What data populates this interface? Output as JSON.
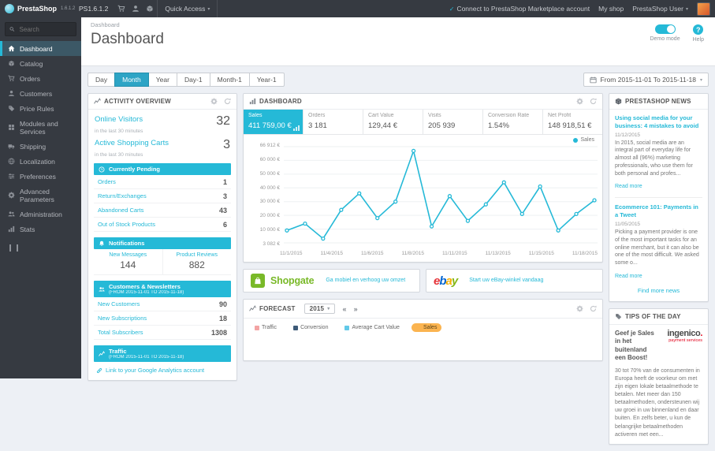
{
  "topbar": {
    "brand": "PrestaShop",
    "brand_version": "1.6.1.2",
    "shop_name": "PS1.6.1.2",
    "quick_access": "Quick Access",
    "marketplace": "Connect to PrestaShop Marketplace account",
    "my_shop": "My shop",
    "user": "PrestaShop User"
  },
  "sidebar": {
    "search_placeholder": "Search",
    "items": [
      {
        "label": "Dashboard",
        "active": true
      },
      {
        "label": "Catalog"
      },
      {
        "label": "Orders"
      },
      {
        "label": "Customers"
      },
      {
        "label": "Price Rules"
      },
      {
        "label": "Modules and Services"
      },
      {
        "label": "Shipping"
      },
      {
        "label": "Localization"
      },
      {
        "label": "Preferences"
      },
      {
        "label": "Advanced Parameters"
      },
      {
        "label": "Administration"
      },
      {
        "label": "Stats"
      }
    ]
  },
  "header": {
    "breadcrumb": "Dashboard",
    "title": "Dashboard",
    "demo_mode": "Demo mode",
    "help": "Help"
  },
  "filters": {
    "buttons": [
      "Day",
      "Month",
      "Year",
      "Day-1",
      "Month-1",
      "Year-1"
    ],
    "active": "Month",
    "date_range": "From 2015-11-01 To 2015-11-18"
  },
  "activity": {
    "title": "ACTIVITY OVERVIEW",
    "online_visitors": {
      "label": "Online Visitors",
      "value": "32",
      "sub": "in the last 30 minutes"
    },
    "active_carts": {
      "label": "Active Shopping Carts",
      "value": "3",
      "sub": "in the last 30 minutes"
    },
    "pending": {
      "title": "Currently Pending",
      "rows": [
        {
          "label": "Orders",
          "value": "1"
        },
        {
          "label": "Return/Exchanges",
          "value": "3"
        },
        {
          "label": "Abandoned Carts",
          "value": "43"
        },
        {
          "label": "Out of Stock Products",
          "value": "6"
        }
      ]
    },
    "notifications": {
      "title": "Notifications",
      "cols": [
        {
          "label": "New Messages",
          "value": "144"
        },
        {
          "label": "Product Reviews",
          "value": "882"
        }
      ]
    },
    "customers": {
      "title": "Customers & Newsletters",
      "subtitle": "(FROM 2015-11-01 TO 2015-11-18)",
      "rows": [
        {
          "label": "New Customers",
          "value": "90"
        },
        {
          "label": "New Subscriptions",
          "value": "18"
        },
        {
          "label": "Total Subscribers",
          "value": "1308"
        }
      ]
    },
    "traffic": {
      "title": "Traffic",
      "subtitle": "(FROM 2015-11-01 TO 2015-11-18)",
      "link": "Link to your Google Analytics account"
    }
  },
  "dashboard_panel": {
    "title": "DASHBOARD",
    "tabs": [
      {
        "label": "Sales",
        "value": "411 759,00 €",
        "active": true
      },
      {
        "label": "Orders",
        "value": "3 181"
      },
      {
        "label": "Cart Value",
        "value": "129,44 €"
      },
      {
        "label": "Visits",
        "value": "205 939"
      },
      {
        "label": "Conversion Rate",
        "value": "1.54%"
      },
      {
        "label": "Net Profit",
        "value": "148 918,51 €"
      }
    ],
    "legend": "Sales"
  },
  "chart_data": {
    "type": "line",
    "title": "Sales 2015-11-01 to 2015-11-18",
    "x": [
      "11/1/2015",
      "11/2/2015",
      "11/3/2015",
      "11/4/2015",
      "11/5/2015",
      "11/6/2015",
      "11/7/2015",
      "11/8/2015",
      "11/9/2015",
      "11/10/2015",
      "11/11/2015",
      "11/12/2015",
      "11/13/2015",
      "11/14/2015",
      "11/15/2015",
      "11/16/2015",
      "11/17/2015",
      "11/18/2015"
    ],
    "series": [
      {
        "name": "Sales",
        "color": "#25b9d7",
        "values": [
          9000,
          14000,
          3082,
          24000,
          36000,
          18000,
          30000,
          66912,
          12000,
          34000,
          16000,
          28000,
          44000,
          21000,
          41000,
          9000,
          21000,
          31000
        ]
      }
    ],
    "ylim": [
      0,
      70000
    ],
    "y_tick_labels": [
      "66 912 €",
      "60 000 €",
      "50 000 €",
      "40 000 €",
      "30 000 €",
      "20 000 €",
      "10 000 €",
      "3 082 €"
    ],
    "x_tick_labels": [
      "11/1/2015",
      "11/4/2015",
      "11/6/2015",
      "11/8/2015",
      "11/11/2015",
      "11/13/2015",
      "11/15/2015",
      "11/18/2015"
    ],
    "grid": true,
    "legend_position": "top-right"
  },
  "modules": {
    "shopgate": {
      "name": "Shopgate",
      "color": "#79b928",
      "link": "Ga mobiel en verhoog uw omzet"
    },
    "ebay": {
      "letters": [
        "e",
        "b",
        "a",
        "y"
      ],
      "colors": [
        "#e53238",
        "#0064d2",
        "#f5af02",
        "#86b817"
      ],
      "link": "Start uw eBay-winkel vandaag"
    }
  },
  "forecast": {
    "title": "FORECAST",
    "year": "2015",
    "legend": [
      {
        "label": "Traffic",
        "color": "#f3a4a4"
      },
      {
        "label": "Conversion",
        "color": "#3d5a78"
      },
      {
        "label": "Average Cart Value",
        "color": "#62c9e8"
      },
      {
        "label": "Sales",
        "color": "#fbb450",
        "active": true
      }
    ]
  },
  "news": {
    "title": "PRESTASHOP NEWS",
    "articles": [
      {
        "title": "Using social media for your business: 4 mistakes to avoid",
        "date": "11/12/2015",
        "body": "In 2015, social media are an integral part of everyday life for almost all (96%) marketing professionals, who use them for both personal and profes...",
        "read_more": "Read more"
      },
      {
        "title": "Ecommerce 101: Payments in a Tweet",
        "date": "11/05/2015",
        "body": "Picking a payment provider is one of the most important tasks for an online merchant, but it can also be one of the most difficult. We asked some o...",
        "read_more": "Read more"
      }
    ],
    "more": "Find more news"
  },
  "tips": {
    "title": "TIPS OF THE DAY",
    "headline": "Geef je Sales in het buitenland een Boost!",
    "brand": "ingenico",
    "brand_sub": "payment services",
    "body": "30 tot 70% van de consumenten in Europa heeft de voorkeur om met zijn eigen lokale betaalmethode te betalen. Met meer dan 150 betaalmethoden, ondersteunen wij uw groei in uw binnenland en daar buiten. En zelfs beter, u kun de belangrijke betaalmethoden activeren met een..."
  },
  "icons": {
    "search-icon": "magnifier",
    "gear-icon": "gear",
    "refresh-icon": "circular-arrow",
    "calendar-icon": "calendar",
    "clock-icon": "clock",
    "bell-icon": "bell",
    "users-icon": "two-people",
    "chart-icon": "line-chart",
    "link-icon": "chain",
    "help-icon": "question-mark",
    "caret-down-icon": "▾",
    "prev-icon": "«",
    "next-icon": "»"
  },
  "colors": {
    "accent": "#25b9d7",
    "topbar": "#363a41",
    "background": "#edf0f5"
  }
}
